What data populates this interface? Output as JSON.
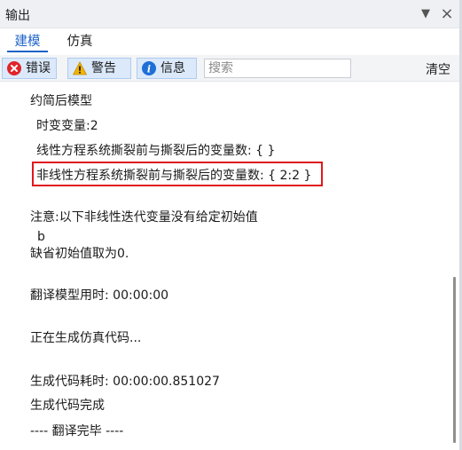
{
  "panel": {
    "title": "输出"
  },
  "tabs": [
    {
      "label": "建模",
      "active": true
    },
    {
      "label": "仿真",
      "active": false
    }
  ],
  "toolbar": {
    "error_label": "错误",
    "warning_label": "警告",
    "info_label": "信息",
    "search_placeholder": "搜索",
    "clear_label": "清空"
  },
  "output_lines": [
    "约简后模型",
    "时变变量:2",
    "线性方程系统撕裂前与撕裂后的变量数: { }",
    "非线性方程系统撕裂前与撕裂后的变量数: { 2:2 }",
    "注意:以下非线性迭代变量没有给定初始值",
    "b",
    "缺省初始值取为0.",
    "翻译模型用时: 00:00:00",
    "正在生成仿真代码...",
    "生成代码耗时: 00:00:00.851027",
    "生成代码完成",
    "---- 翻译完毕 ----"
  ],
  "colors": {
    "accent": "#1e64c8",
    "highlight_border": "#e0171b",
    "button_bg": "#dbe9fb",
    "error_icon": "#e0242a",
    "warning_icon": "#f2b400",
    "info_icon": "#1e6fd6"
  }
}
